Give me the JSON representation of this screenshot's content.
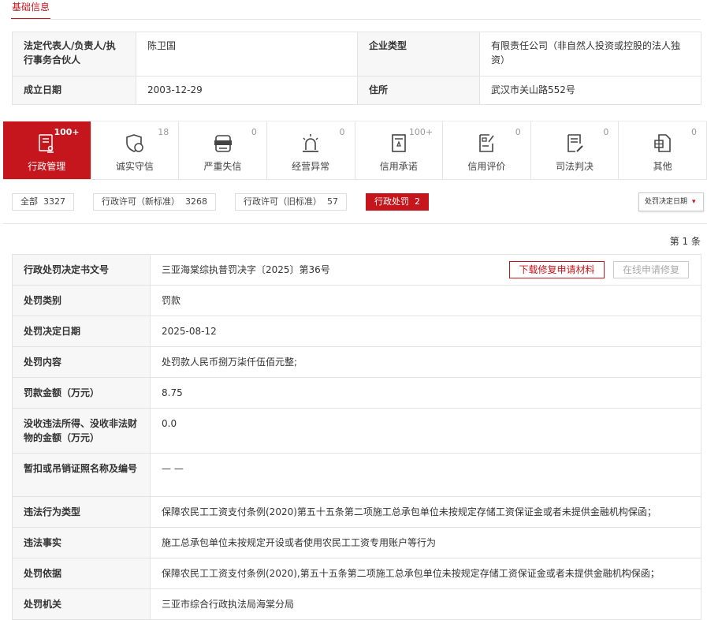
{
  "section_title": "基础信息",
  "basic": {
    "rep_label": "法定代表人/负责人/执行事务合伙人",
    "rep_value": "陈卫国",
    "type_label": "企业类型",
    "type_value": "有限责任公司（非自然人投资或控股的法人独资）",
    "date_label": "成立日期",
    "date_value": "2003-12-29",
    "addr_label": "住所",
    "addr_value": "武汉市关山路552号"
  },
  "tabs": [
    {
      "label": "行政管理",
      "count": "100+",
      "icon": "admin-document-icon"
    },
    {
      "label": "诚实守信",
      "count": "18",
      "icon": "shield-icon"
    },
    {
      "label": "严重失信",
      "count": "0",
      "icon": "dishonest-person-icon"
    },
    {
      "label": "经营异常",
      "count": "0",
      "icon": "alarm-light-icon"
    },
    {
      "label": "信用承诺",
      "count": "100+",
      "icon": "commitment-certificate-icon"
    },
    {
      "label": "信用评价",
      "count": "0",
      "icon": "evaluation-icon"
    },
    {
      "label": "司法判决",
      "count": "0",
      "icon": "judgment-icon"
    },
    {
      "label": "其他",
      "count": "0",
      "icon": "other-document-icon"
    }
  ],
  "filters": [
    {
      "label": "全部",
      "count": "3327"
    },
    {
      "label": "行政许可（新标准）",
      "count": "3268"
    },
    {
      "label": "行政许可（旧标准）",
      "count": "57"
    },
    {
      "label": "行政处罚",
      "count": "2"
    }
  ],
  "sort_label": "处罚决定日期",
  "record_count": "第 1 条",
  "buttons": {
    "download": "下载修复申请材料",
    "online": "在线申请修复"
  },
  "detail": [
    {
      "label": "行政处罚决定书文号",
      "value": "三亚海棠综执普罚决字〔2025〕第36号"
    },
    {
      "label": "处罚类别",
      "value": "罚款"
    },
    {
      "label": "处罚决定日期",
      "value": "2025-08-12"
    },
    {
      "label": "处罚内容",
      "value": "处罚款人民币捌万柒仟伍佰元整;"
    },
    {
      "label": "罚款金额（万元）",
      "value": "8.75"
    },
    {
      "label": "没收违法所得、没收非法财物的金额（万元）",
      "value": "0.0"
    },
    {
      "label": "暂扣或吊销证照名称及编号",
      "value": "— —"
    },
    {
      "label": "违法行为类型",
      "value": "保障农民工工资支付条例(2020)第五十五条第二项施工总承包单位未按规定存储工资保证金或者未提供金融机构保函；"
    },
    {
      "label": "违法事实",
      "value": "施工总承包单位未按规定开设或者使用农民工工资专用账户等行为"
    },
    {
      "label": "处罚依据",
      "value": "保障农民工工资支付条例(2020),第五十五条第二项施工总承包单位未按规定存储工资保证金或者未提供金融机构保函；"
    },
    {
      "label": "处罚机关",
      "value": "三亚市综合行政执法局海棠分局"
    }
  ]
}
